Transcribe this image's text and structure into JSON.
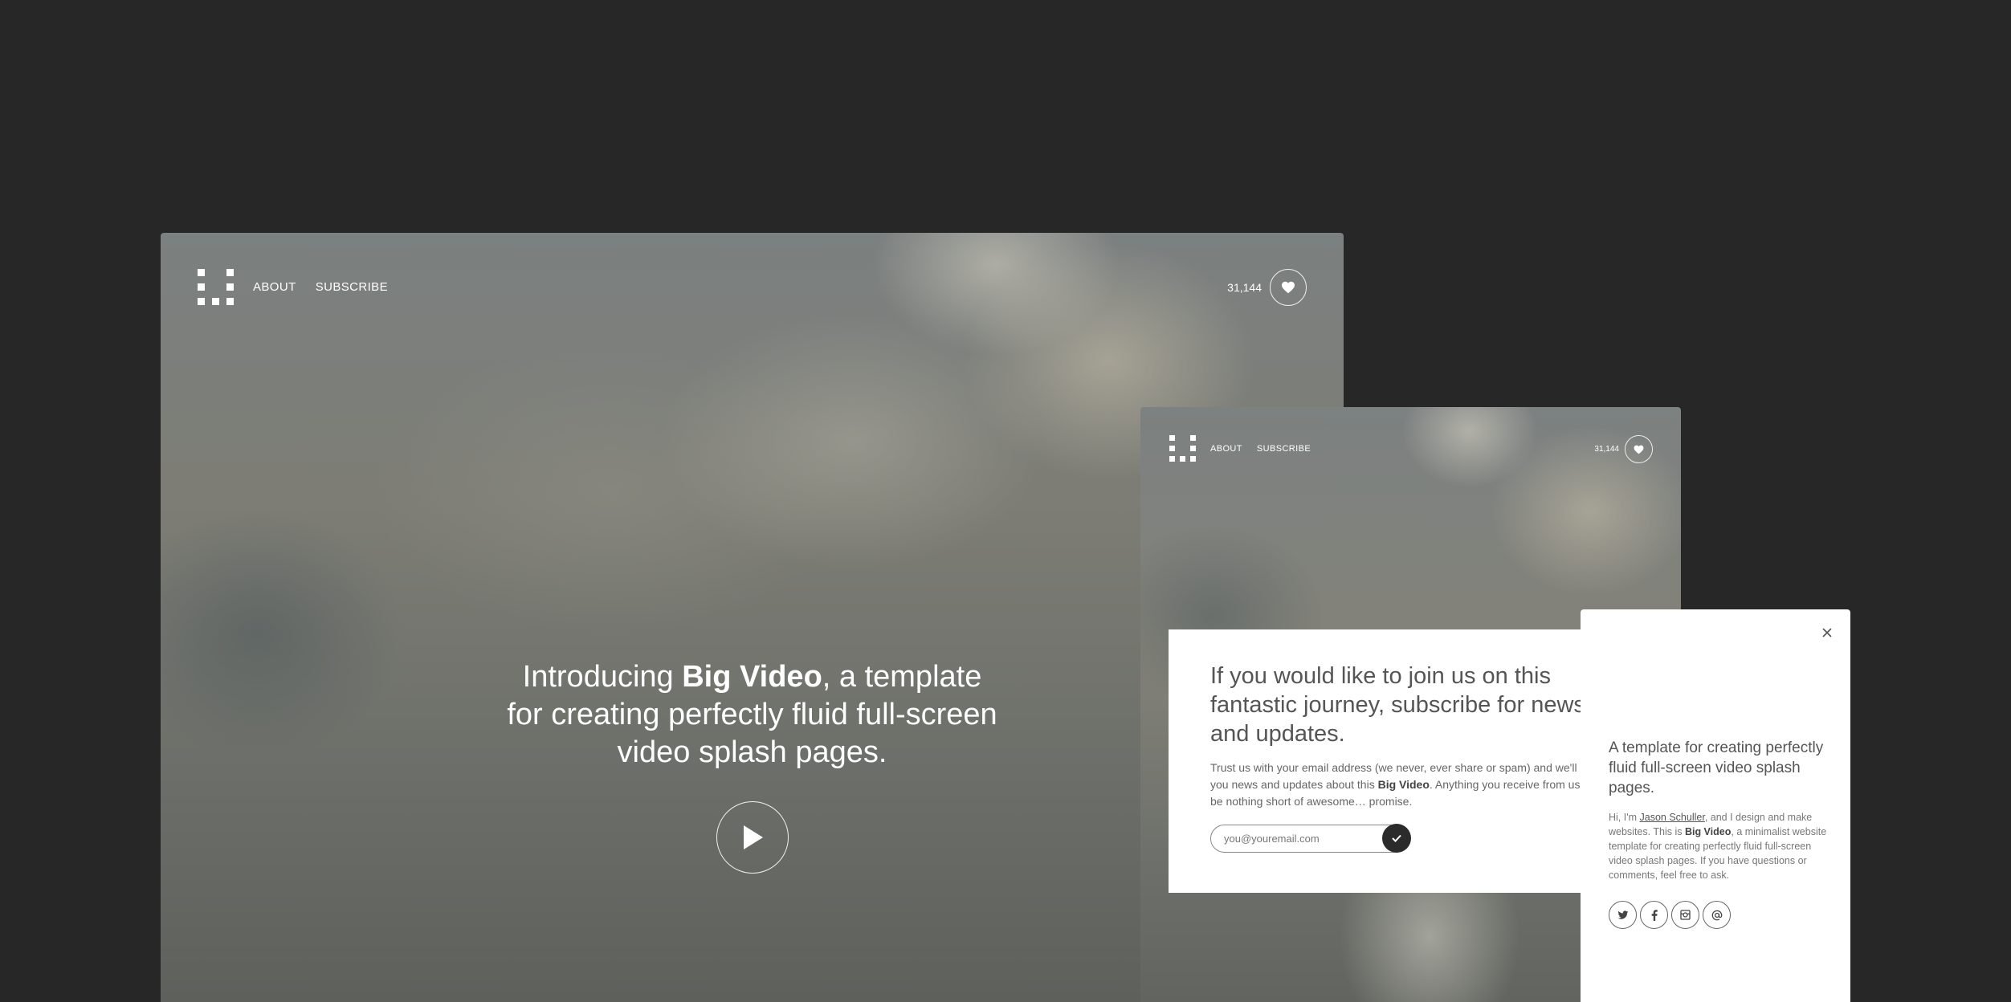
{
  "large_frame": {
    "nav": {
      "about": "ABOUT",
      "subscribe": "SUBSCRIBE"
    },
    "likes": "31,144",
    "hero": {
      "intro": "Introducing ",
      "brand": "Big Video",
      "line1_rest": ", a template",
      "line2": "for creating perfectly fluid full-screen",
      "line3": "video splash pages."
    }
  },
  "tablet_frame": {
    "nav": {
      "about": "ABOUT",
      "subscribe": "SUBSCRIBE"
    },
    "likes": "31,144",
    "subscribe_panel": {
      "title": "If you would like to join us on this fantastic journey, subscribe for news and updates.",
      "body_start": "Trust us with your email address (we never, ever share or spam) and we'll send you news and updates about this ",
      "brand": "Big Video",
      "body_end": ". Anything you receive from us will be nothing short of awesome… promise.",
      "email_placeholder": "you@youremail.com"
    }
  },
  "phone_frame": {
    "title": "A template for creating perfectly fluid full-screen video splash pages.",
    "body_start": "Hi, I'm ",
    "author": "Jason Schuller",
    "body_mid": ", and I design and make websites. This is ",
    "brand": "Big Video",
    "body_end": ", a minimalist website template for creating perfectly fluid full-screen video splash pages. If you have questions or comments, feel free to ask.",
    "social": [
      "twitter-icon",
      "facebook-icon",
      "instagram-icon",
      "email-at-icon"
    ]
  },
  "colors": {
    "background": "#272727",
    "panel": "#ffffff",
    "submit": "#2b2b2b"
  }
}
